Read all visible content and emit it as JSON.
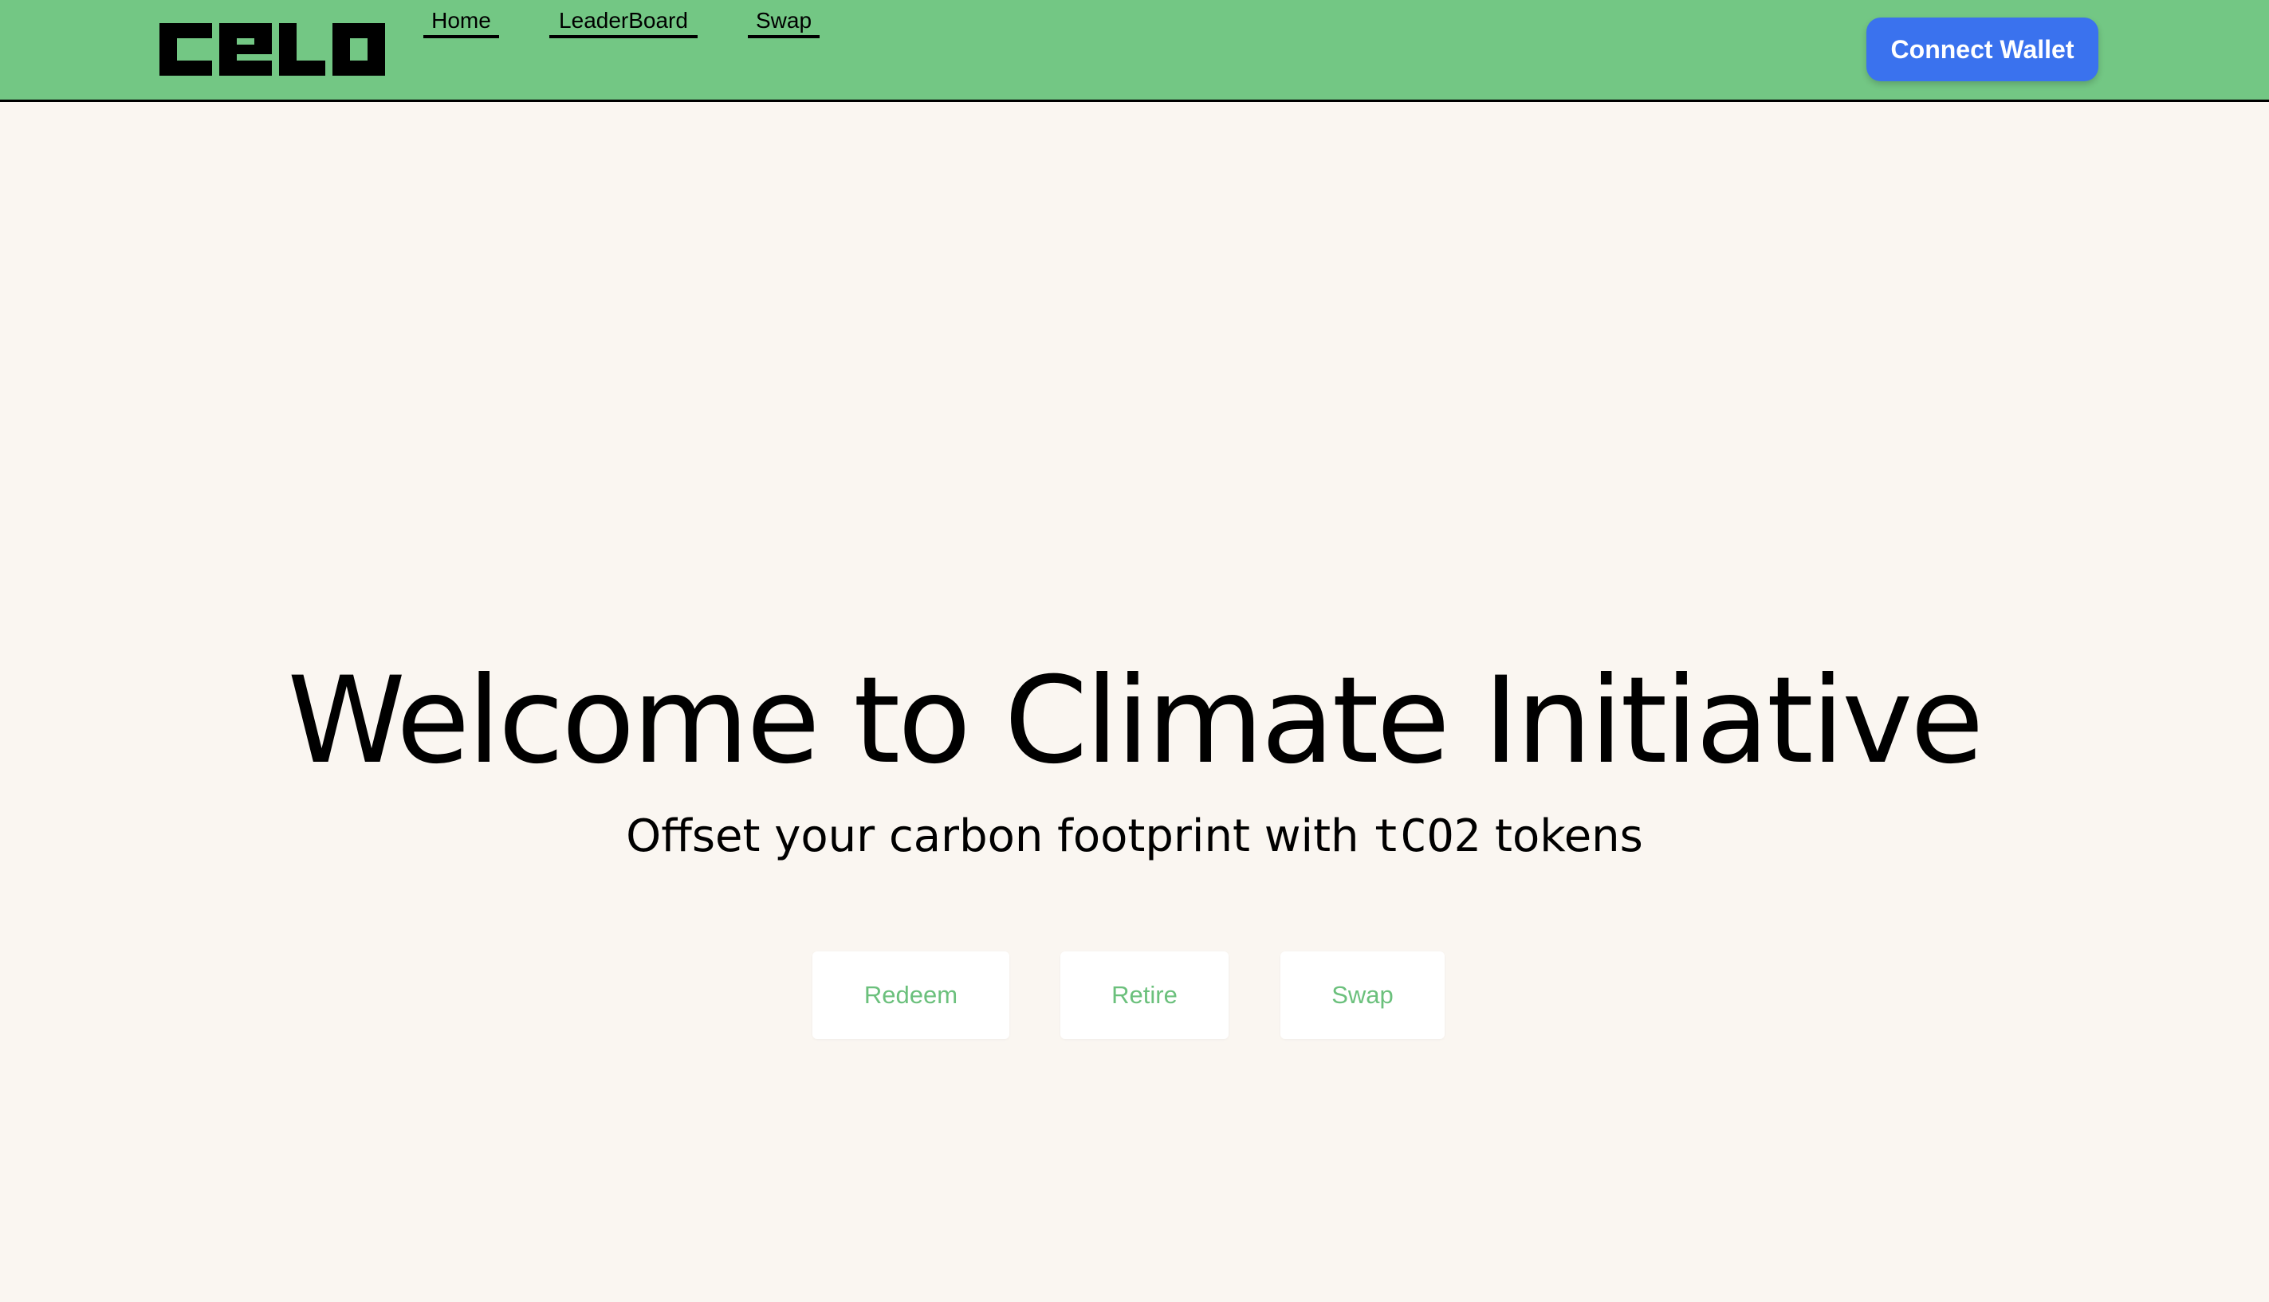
{
  "brand": {
    "logo_text": "celo",
    "header_color": "#73C784",
    "accent_green": "#6BC07C",
    "button_blue": "#3A72EE",
    "background": "#FAF6F1"
  },
  "nav": {
    "items": [
      {
        "label": "Home"
      },
      {
        "label": "LeaderBoard"
      },
      {
        "label": "Swap"
      }
    ]
  },
  "header": {
    "connect_wallet_label": "Connect Wallet"
  },
  "hero": {
    "title": "Welcome to Climate Initiative",
    "subtitle_prefix": "Offset your carbon footprint with",
    "subtitle_token": "tCO2",
    "subtitle_suffix": "tokens"
  },
  "actions": {
    "buttons": [
      {
        "label": "Redeem"
      },
      {
        "label": "Retire"
      },
      {
        "label": "Swap"
      }
    ]
  }
}
